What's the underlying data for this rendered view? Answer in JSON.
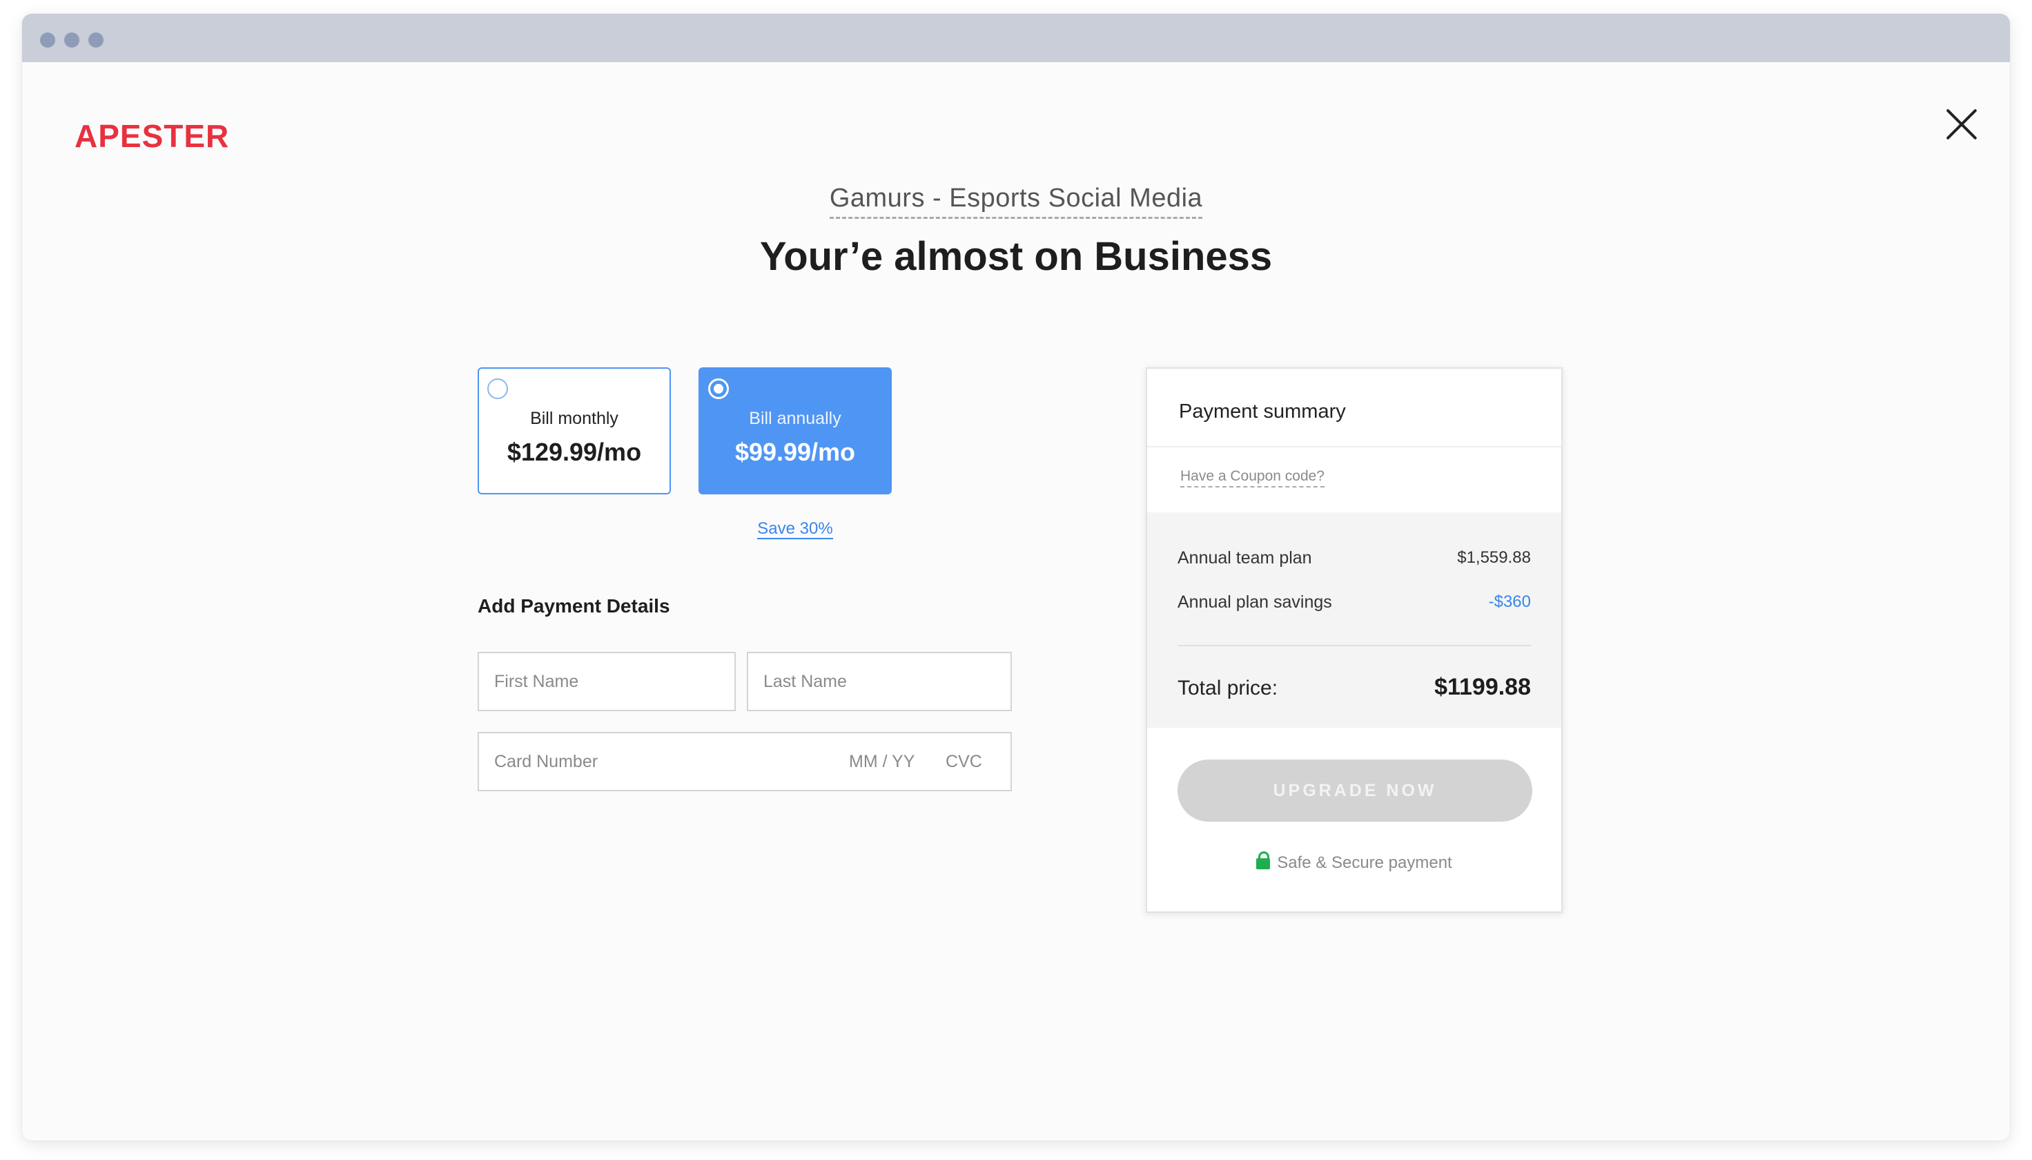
{
  "brand": {
    "logo_text": "APESTER",
    "logo_color": "#e8313f"
  },
  "header": {
    "project_name": "Gamurs - Esports Social Media",
    "title": "Your’e almost on Business"
  },
  "billing": {
    "options": [
      {
        "label": "Bill monthly",
        "price": "$129.99/mo",
        "selected": false
      },
      {
        "label": "Bill annually",
        "price": "$99.99/mo",
        "selected": true
      }
    ],
    "save_link": "Save 30%"
  },
  "payment_form": {
    "section_title": "Add Payment Details",
    "first_name_placeholder": "First Name",
    "last_name_placeholder": "Last Name",
    "card_number_placeholder": "Card Number",
    "expiry_placeholder": "MM / YY",
    "cvc_placeholder": "CVC"
  },
  "summary": {
    "title": "Payment summary",
    "coupon_link": "Have a Coupon code?",
    "rows": [
      {
        "label": "Annual team plan",
        "value": "$1,559.88"
      },
      {
        "label": "Annual plan savings",
        "value": "-$360"
      }
    ],
    "total_label": "Total price:",
    "total_value": "$1199.88",
    "upgrade_button": "UPGRADE NOW",
    "secure_text": "Safe & Secure payment"
  },
  "colors": {
    "accent": "#4f95f3",
    "link": "#3a86ec",
    "secure": "#1fae4f",
    "button_disabled": "#d3d3d3"
  }
}
